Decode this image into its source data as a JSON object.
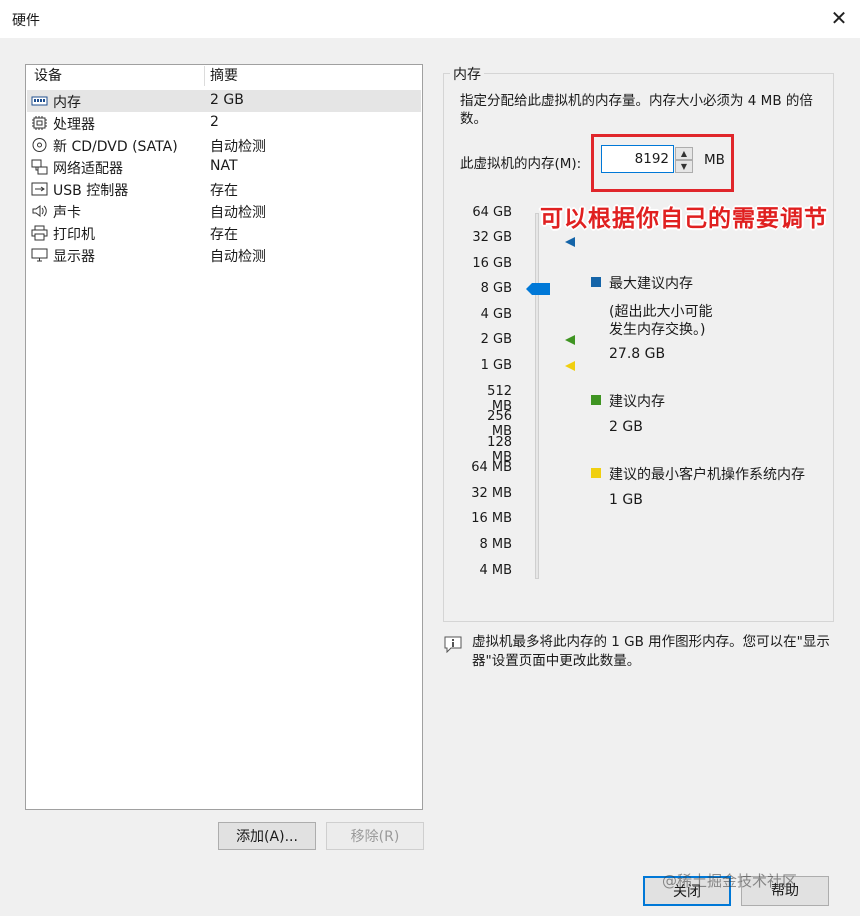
{
  "window": {
    "title": "硬件",
    "close_glyph": "✕"
  },
  "device_table": {
    "headers": {
      "device": "设备",
      "summary": "摘要"
    },
    "rows": [
      {
        "name": "内存",
        "summary": "2 GB",
        "icon": "memory-icon",
        "selected": true
      },
      {
        "name": "处理器",
        "summary": "2",
        "icon": "processor-icon"
      },
      {
        "name": "新 CD/DVD (SATA)",
        "summary": "自动检测",
        "icon": "cd-dvd-icon"
      },
      {
        "name": "网络适配器",
        "summary": "NAT",
        "icon": "network-adapter-icon"
      },
      {
        "name": "USB 控制器",
        "summary": "存在",
        "icon": "usb-icon"
      },
      {
        "name": "声卡",
        "summary": "自动检测",
        "icon": "speaker-icon"
      },
      {
        "name": "打印机",
        "summary": "存在",
        "icon": "printer-icon"
      },
      {
        "name": "显示器",
        "summary": "自动检测",
        "icon": "monitor-icon"
      }
    ]
  },
  "buttons": {
    "add": "添加(A)...",
    "remove": "移除(R)",
    "close": "关闭",
    "help": "帮助"
  },
  "memory": {
    "group_title": "内存",
    "description": "指定分配给此虚拟机的内存量。内存大小必须为 4 MB 的倍数。",
    "field_label": "此虚拟机的内存(M):",
    "value": "8192",
    "unit": "MB",
    "annotation": "可以根据你自己的需要调节",
    "scale_labels": [
      "64 GB",
      "32 GB",
      "16 GB",
      "8 GB",
      "4 GB",
      "2 GB",
      "1 GB",
      "512 MB",
      "256 MB",
      "128 MB",
      "64 MB",
      "32 MB",
      "16 MB",
      "8 MB",
      "4 MB"
    ],
    "legend": {
      "max": {
        "title": "最大建议内存",
        "note_line1": "(超出此大小可能",
        "note_line2": "发生内存交换。)",
        "value": "27.8 GB",
        "color": "#1464a8"
      },
      "recommended": {
        "title": "建议内存",
        "value": "2 GB",
        "color": "#3f9422"
      },
      "min": {
        "title": "建议的最小客户机操作系统内存",
        "value": "1 GB",
        "color": "#f0cf10"
      }
    },
    "info": "虚拟机最多将此内存的 1 GB 用作图形内存。您可以在\"显示器\"设置页面中更改此数量。",
    "slider_color": "#0078d7"
  },
  "watermark": "@稀土掘金技术社区"
}
